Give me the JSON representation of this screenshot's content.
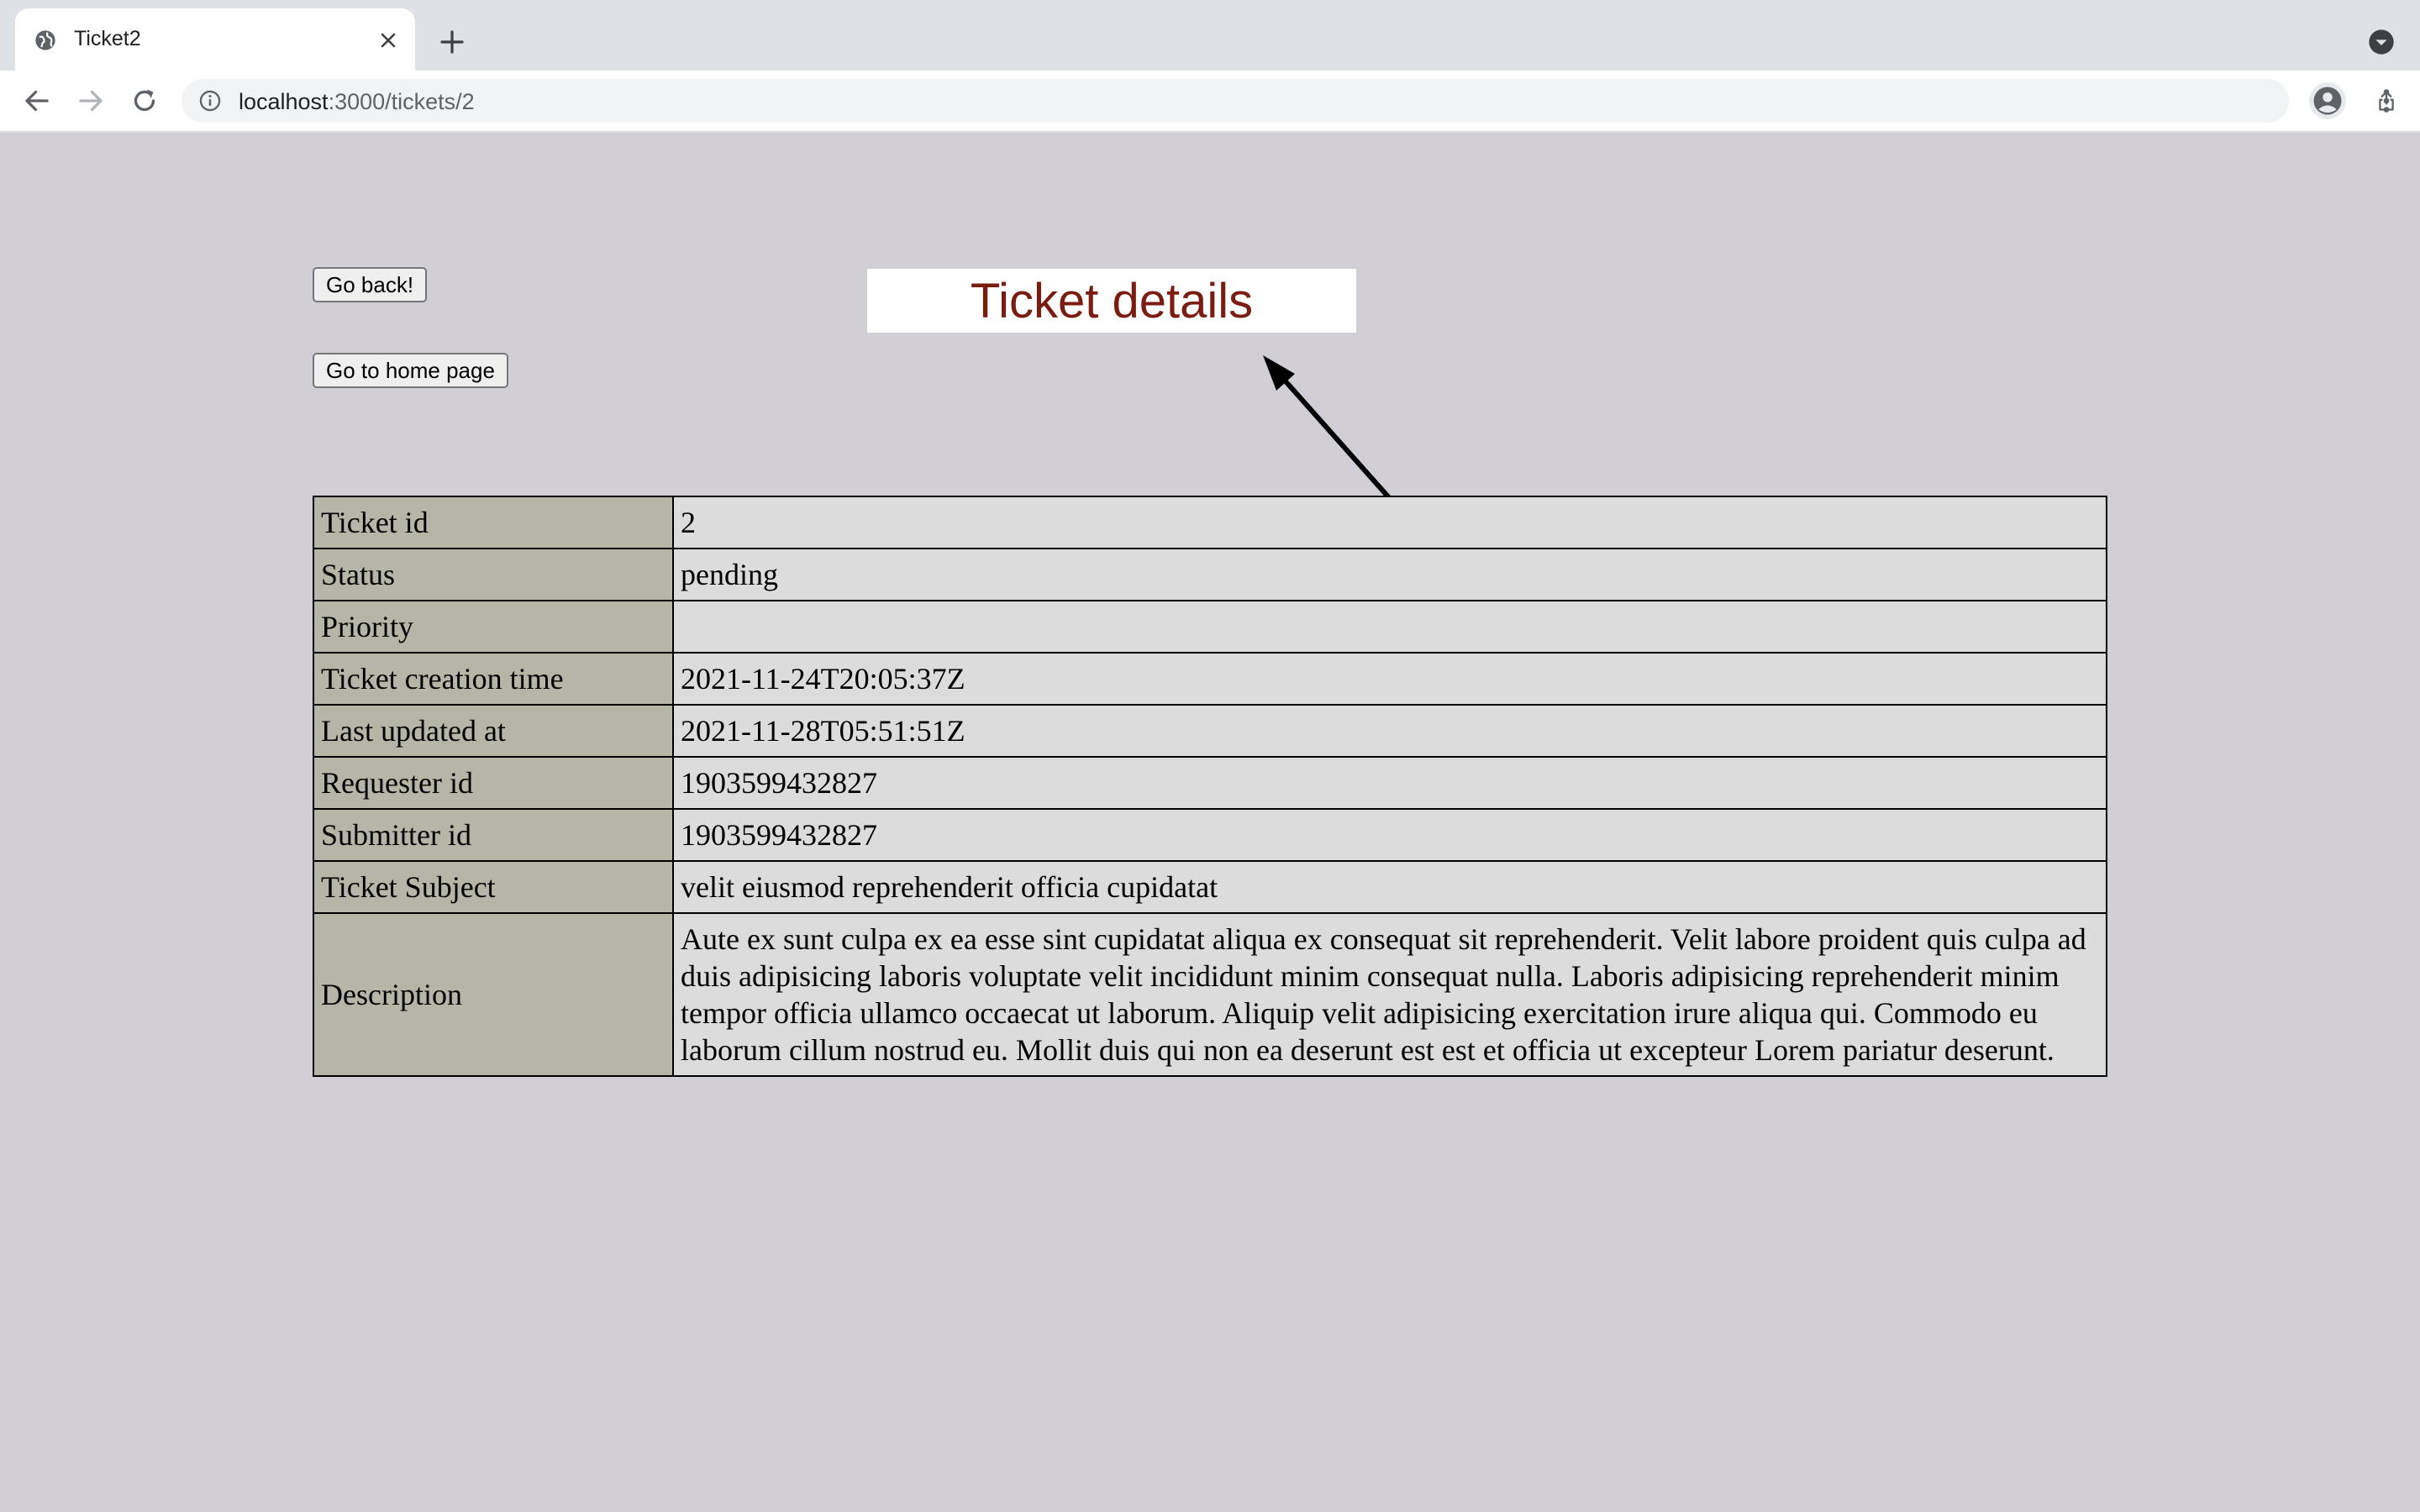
{
  "browser": {
    "tab_title": "Ticket2",
    "url_host": "localhost",
    "url_path": ":3000/tickets/2",
    "icons": [
      "globe-icon",
      "close-icon",
      "plus-icon",
      "tab-search-icon",
      "back-icon",
      "forward-icon",
      "reload-icon",
      "info-icon",
      "share-icon",
      "star-icon",
      "profile-icon",
      "more-vert-icon"
    ]
  },
  "page": {
    "go_back_label": "Go back!",
    "home_label": "Go to home page",
    "title": "Ticket details",
    "title_color": "#7a1c10",
    "background": "#d1ced6"
  },
  "ticket": {
    "rows": [
      {
        "label": "Ticket id",
        "value": "2"
      },
      {
        "label": "Status",
        "value": "pending"
      },
      {
        "label": "Priority",
        "value": ""
      },
      {
        "label": "Ticket creation time",
        "value": "2021-11-24T20:05:37Z"
      },
      {
        "label": "Last updated at",
        "value": "2021-11-28T05:51:51Z"
      },
      {
        "label": "Requester id",
        "value": "1903599432827"
      },
      {
        "label": "Submitter id",
        "value": "1903599432827"
      },
      {
        "label": "Ticket Subject",
        "value": "velit eiusmod reprehenderit officia cupidatat"
      },
      {
        "label": "Description",
        "value": "Aute ex sunt culpa ex ea esse sint cupidatat aliqua ex consequat sit reprehenderit. Velit labore proident quis culpa ad duis adipisicing laboris voluptate velit incididunt minim consequat nulla. Laboris adipisicing reprehenderit minim tempor officia ullamco occaecat ut laborum. Aliquip velit adipisicing exercitation irure aliqua qui. Commodo eu laborum cillum nostrud eu. Mollit duis qui non ea deserunt est est et officia ut excepteur Lorem pariatur deserunt."
      }
    ]
  }
}
